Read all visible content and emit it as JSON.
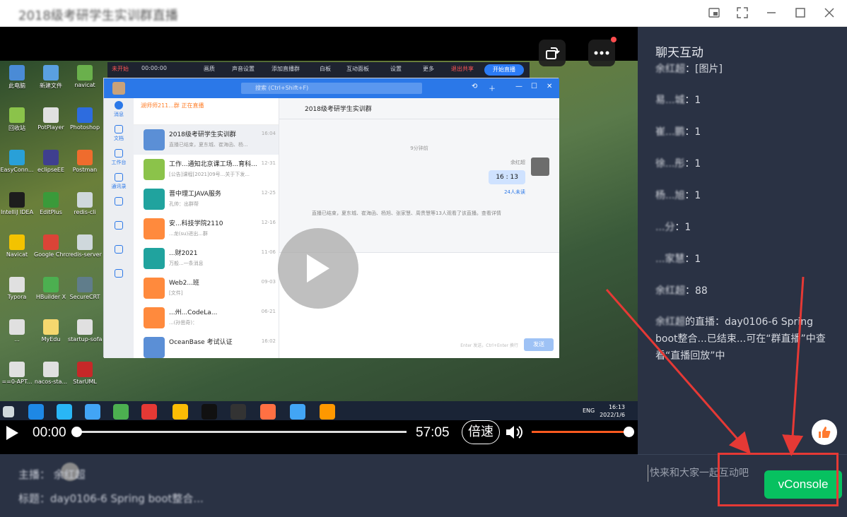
{
  "window": {
    "title": "2018级考研学生实训群直播",
    "buttons": [
      "pip",
      "fullscreen",
      "minimize",
      "maximize",
      "close"
    ]
  },
  "video": {
    "live_bar": {
      "status": "未开始",
      "timer": "00:00:00",
      "items": [
        "画质",
        "声音设置",
        "添加直播群",
        "白板",
        "互动面板",
        "设置",
        "更多"
      ],
      "exit_share": "退出共享",
      "start_label": "开始直播"
    },
    "qq": {
      "search_placeholder": "搜索 (Ctrl+Shift+F)",
      "banner": "湖师师211...群 正在直播",
      "list": [
        {
          "name": "2018级考研学生实训群",
          "msg": "直播已结束，夏东城、崔海函、杨...",
          "time": "16:04",
          "selected": true
        },
        {
          "name": "工作...通知北京课工场...育科...",
          "msg": "[公告]课程[2021]09号...关于下发...",
          "time": "12-31",
          "selected": false
        },
        {
          "name": "晋中理工JAVA服务",
          "msg": "孔帅：出群帮",
          "time": "12-25",
          "selected": false
        },
        {
          "name": "安...科技学院2110",
          "msg": "...龙(su)进出...群",
          "time": "12-16",
          "selected": false
        },
        {
          "name": "...财2021",
          "msg": "万般...一条消息",
          "time": "11-06",
          "selected": false
        },
        {
          "name": "Web2...班",
          "msg": "[文件]",
          "time": "09-03",
          "selected": false
        },
        {
          "name": "...州...CodeLa...",
          "msg": "...(孙思奇)：",
          "time": "06-21",
          "selected": false
        },
        {
          "name": "OceanBase 考试认证",
          "msg": "",
          "time": "16:02",
          "selected": false
        }
      ],
      "chat_title": "2018级考研学生实训群",
      "time_divider": "9分钟前",
      "bubble_sender": "余红超",
      "bubble": "16 : 13",
      "unread": "24人未读",
      "system_msg": "直播已结束，夏东城、崔海函、杨旭、张家慧、周贵慧等13人观看了该直播。查看详情",
      "send_label": "发送",
      "send_hint": "Enter 发送，Ctrl+Enter 换行"
    },
    "taskbar": {
      "time": "16:13",
      "date": "2022/1/6",
      "lang": "ENG"
    }
  },
  "controls": {
    "current_time": "00:00",
    "total_time": "57:05",
    "progress": 0,
    "speed_label": "倍速",
    "volume": 1
  },
  "info": {
    "anchor": "主播：   余红超",
    "topic": "标题：day0106-6 Spring boot整合..."
  },
  "chat": {
    "title": "聊天互动",
    "messages": [
      {
        "name": "余红超",
        "text": "：[图片]"
      },
      {
        "name": "易...城",
        "text": "：1"
      },
      {
        "name": "崔...鹏",
        "text": "：1"
      },
      {
        "name": "徐...彤",
        "text": "：1"
      },
      {
        "name": "杨...旭",
        "text": "：1"
      },
      {
        "name": "...分",
        "text": "：1"
      },
      {
        "name": "...家慧",
        "text": "：1"
      },
      {
        "name": "余红超",
        "text": "：88"
      },
      {
        "name": "余红超",
        "text": "的直播：day0106-6 Spring boot整合...已结束...可在“群直播”中查看“直播回放”中"
      }
    ],
    "input_placeholder": "快来和大家一起互动吧",
    "vconsole_label": "vConsole"
  },
  "annotation": {
    "color": "#e53935"
  }
}
